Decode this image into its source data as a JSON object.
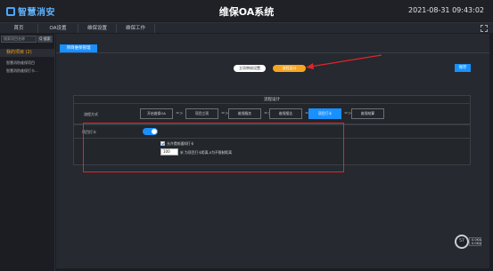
{
  "header": {
    "logo_text": "智慧消安",
    "title": "维保OA系统",
    "datetime": "2021-08-31  09:43:02"
  },
  "nav": {
    "items": [
      {
        "label": "首页"
      },
      {
        "label": "OA设置"
      },
      {
        "label": "维保设置"
      },
      {
        "label": "维保工作"
      }
    ]
  },
  "sidebar": {
    "search_placeholder": "搜索项目名称",
    "search_button": "Q 搜索",
    "group_label": "我的项目 (2)",
    "items": [
      {
        "label": "智慧消防维保项目"
      },
      {
        "label": "智慧消防维保打卡..."
      }
    ]
  },
  "main": {
    "active_tab": "项目维保管理",
    "approval_button": "立项审核设置",
    "flow_button": "流程设计",
    "save_button": "保存"
  },
  "flow": {
    "title": "流程设计",
    "mode_label": "流程方式",
    "steps": [
      {
        "label": "开启维保OA",
        "active": false
      },
      {
        "label": "项目立项",
        "active": false
      },
      {
        "label": "维保服务",
        "active": false
      },
      {
        "label": "维保报告",
        "active": false
      },
      {
        "label": "项目打卡",
        "active": true
      },
      {
        "label": "维保结算",
        "active": false
      }
    ],
    "step_arrow": "=>"
  },
  "clockin": {
    "label": "项目打卡",
    "toggle_on": true,
    "checkbox_label": "允许提前通知打卡",
    "checkbox_checked": true,
    "count_value": "100",
    "count_suffix": "米 为项目打卡距离,0为不限制距离"
  },
  "widget": {
    "percent": "57",
    "side_line1": "0.0K/s",
    "side_line2": "0.0K/s"
  },
  "colors": {
    "accent": "#1990ff",
    "orange": "#f5a623",
    "highlight": "#e0262b"
  }
}
